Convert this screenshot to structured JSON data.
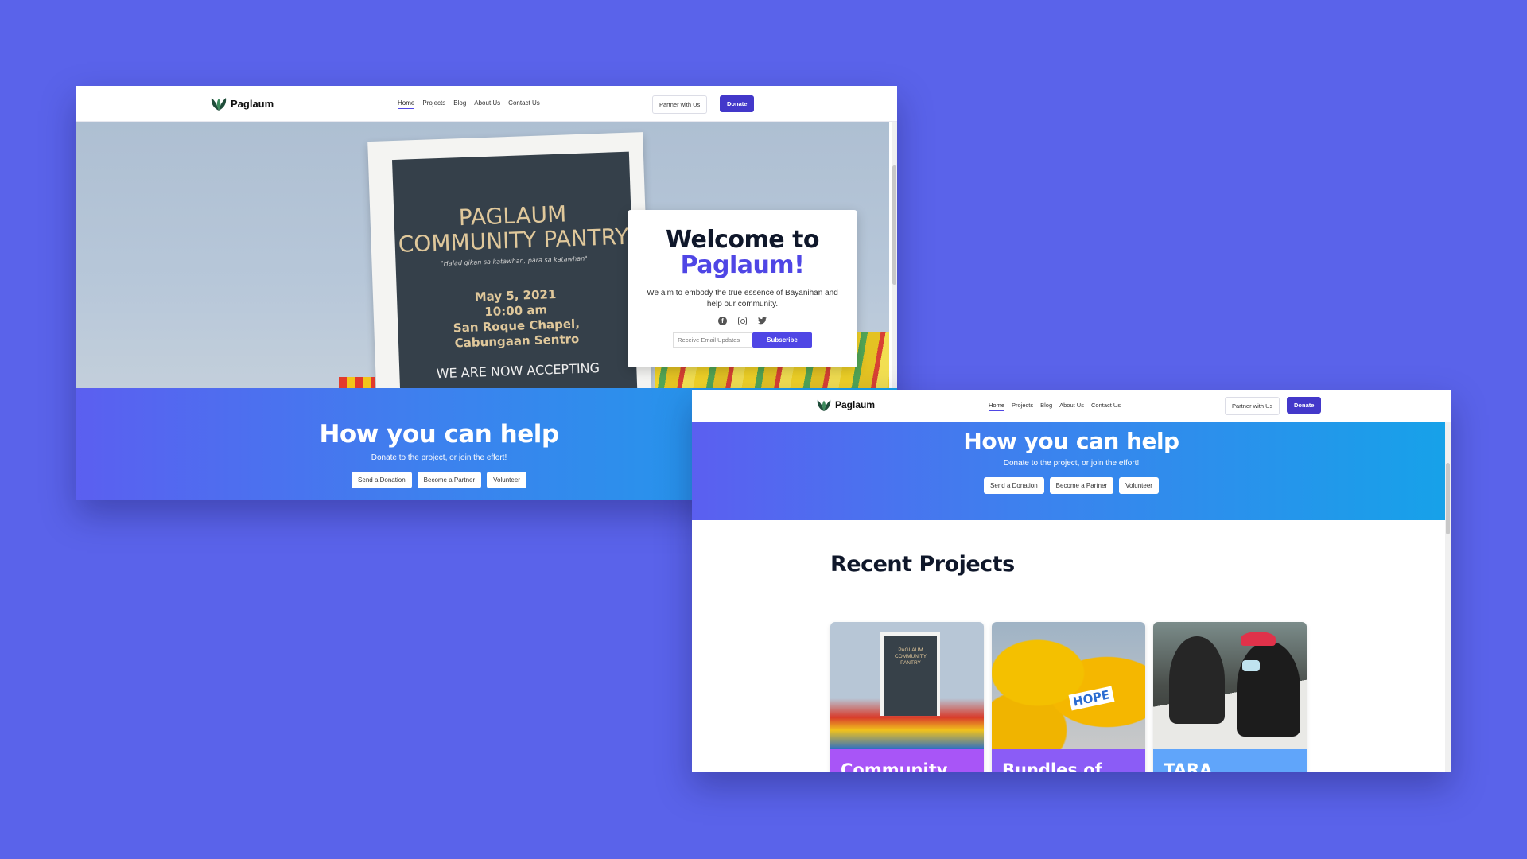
{
  "brand": {
    "name": "Paglaum"
  },
  "nav": {
    "links": [
      "Home",
      "Projects",
      "Blog",
      "About Us",
      "Contact Us"
    ],
    "partner_label": "Partner with Us",
    "donate_label": "Donate"
  },
  "hero": {
    "poster": {
      "title_line1": "PAGLAUM",
      "title_line2": "COMMUNITY PANTRY",
      "motto": "\"Halad gikan sa katawhan, para sa katawhan\"",
      "date": "May 5, 2021",
      "time": "10:00 am",
      "venue_line1": "San Roque Chapel,",
      "venue_line2": "Cabungaan Sentro",
      "accepting": "WE ARE NOW ACCEPTING"
    },
    "welcome_line1": "Welcome to",
    "welcome_brand": "Paglaum!",
    "welcome_sub": "We aim to embody the true essence of Bayanihan and help our community.",
    "email_placeholder": "Receive Email Updates",
    "subscribe_label": "Subscribe"
  },
  "help": {
    "title": "How you can help",
    "subtitle": "Donate to the project, or join the effort!",
    "buttons": [
      "Send a Donation",
      "Become a Partner",
      "Volunteer"
    ]
  },
  "recent": {
    "title": "Recent Projects",
    "cards": [
      {
        "label": "Community",
        "poster_text": "PAGLAUM COMMUNITY PANTRY"
      },
      {
        "label": "Bundles of",
        "tag": "HOPE"
      },
      {
        "label": "TARA"
      }
    ]
  },
  "colors": {
    "background": "#5a63ea",
    "accent": "#4f46e5",
    "donate": "#4338ca",
    "card1": "#a855f7",
    "card2": "#8b5cf6",
    "card3": "#60a5fa"
  },
  "icons": [
    "paglaum-logo-icon",
    "facebook-icon",
    "instagram-icon",
    "twitter-icon"
  ]
}
